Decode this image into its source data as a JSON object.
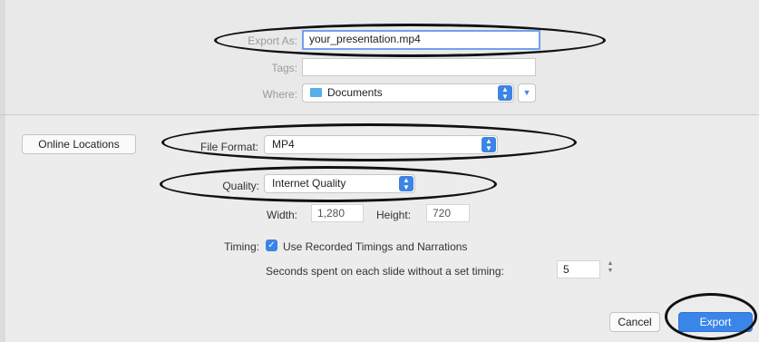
{
  "save": {
    "export_as_label": "Export As:",
    "export_as_value": "your_presentation.mp4",
    "tags_label": "Tags:",
    "tags_value": "",
    "where_label": "Where:",
    "where_value": "Documents"
  },
  "options": {
    "online_locations": "Online Locations",
    "file_format_label": "File Format:",
    "file_format_value": "MP4",
    "quality_label": "Quality:",
    "quality_value": "Internet Quality",
    "width_label": "Width:",
    "width_value": "1,280",
    "height_label": "Height:",
    "height_value": "720",
    "timing_label": "Timing:",
    "timing_checkbox_label": "Use Recorded Timings and Narrations",
    "timing_checked": true,
    "seconds_label": "Seconds spent on each slide without a set timing:",
    "seconds_value": "5"
  },
  "buttons": {
    "cancel": "Cancel",
    "export": "Export"
  },
  "colors": {
    "accent": "#3a86e8",
    "annotation": "#111111"
  }
}
